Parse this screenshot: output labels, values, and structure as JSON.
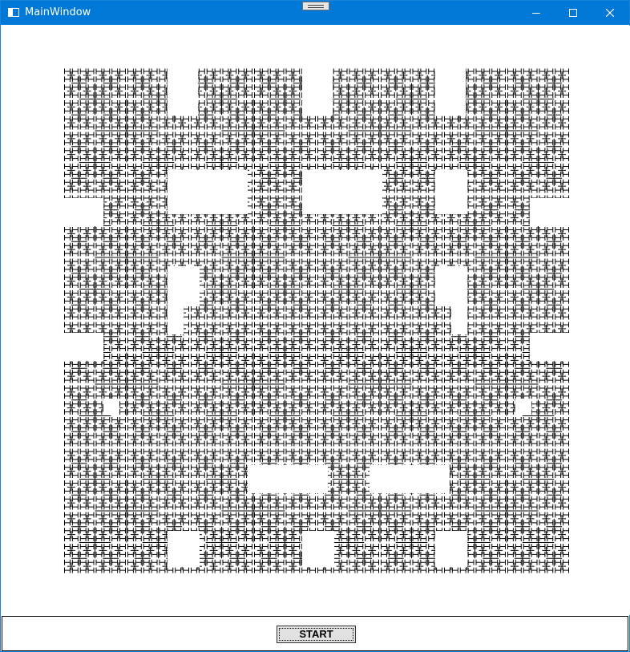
{
  "window": {
    "title": "MainWindow",
    "accent": "#0078d7"
  },
  "title_controls": {
    "minimize": "minimize-icon",
    "maximize": "maximize-icon",
    "close": "close-icon"
  },
  "fractal": {
    "stroke": "#000000",
    "depth": 4
  },
  "toolbar": {
    "start_label": "START"
  }
}
